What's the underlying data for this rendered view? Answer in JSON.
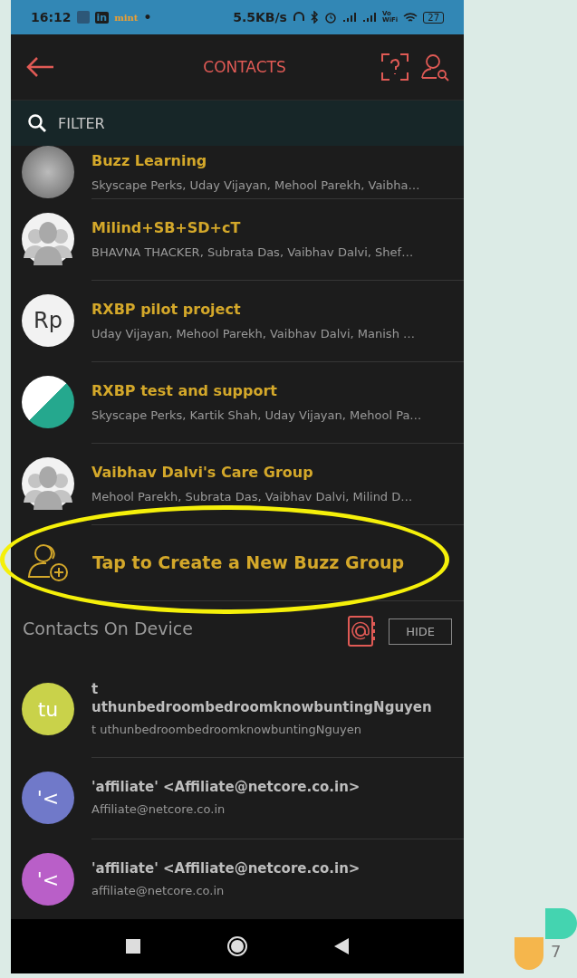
{
  "status_bar": {
    "time": "16:12",
    "app_badge": "in",
    "app_name": "mint",
    "dot": "•",
    "speed": "5.5KB/s",
    "vowifi_top": "Vo",
    "vowifi_bottom": "WiFi",
    "battery": "27"
  },
  "header": {
    "title": "CONTACTS"
  },
  "filter": {
    "placeholder": "FILTER"
  },
  "groups": [
    {
      "name": "Buzz Learning",
      "members": "Skyscape Perks, Uday Vijayan, Mehool Parekh, Vaibha…",
      "avatar": {
        "kind": "photo"
      }
    },
    {
      "name": "Milind+SB+SD+cT",
      "members": "BHAVNA THACKER, Subrata Das, Vaibhav  Dalvi, Shef…",
      "avatar": {
        "kind": "group"
      }
    },
    {
      "name": "RXBP pilot project",
      "members": "Uday Vijayan, Mehool Parekh, Vaibhav  Dalvi, Manish …",
      "avatar": {
        "kind": "initials",
        "initials": "Rp"
      }
    },
    {
      "name": "RXBP test and support",
      "members": "Skyscape Perks, Kartik Shah, Uday Vijayan, Mehool Pa…",
      "avatar": {
        "kind": "poster"
      }
    },
    {
      "name": "Vaibhav Dalvi's Care Group",
      "members": "Mehool Parekh, Subrata Das, Vaibhav  Dalvi, Milind D…",
      "avatar": {
        "kind": "group"
      }
    }
  ],
  "create_group": {
    "label": "Tap to Create a New Buzz Group"
  },
  "device_section": {
    "title": "Contacts On Device",
    "hide_button": "HIDE"
  },
  "contacts": [
    {
      "initials": "tu",
      "color": "#c9d24a",
      "name_line1": "t",
      "name_line2": "uthunbedroombedroomknowbuntingNguyen",
      "detail": "t  uthunbedroombedroomknowbuntingNguyen"
    },
    {
      "initials": "'<",
      "color": "#7079c9",
      "name_line1": "'affiliate' <Affiliate@netcore.co.in>",
      "detail": "Affiliate@netcore.co.in"
    },
    {
      "initials": "'<",
      "color": "#b95fc8",
      "name_line1": "'affiliate' <Affiliate@netcore.co.in>",
      "detail": "affiliate@netcore.co.in"
    }
  ],
  "corner_badge": "7"
}
